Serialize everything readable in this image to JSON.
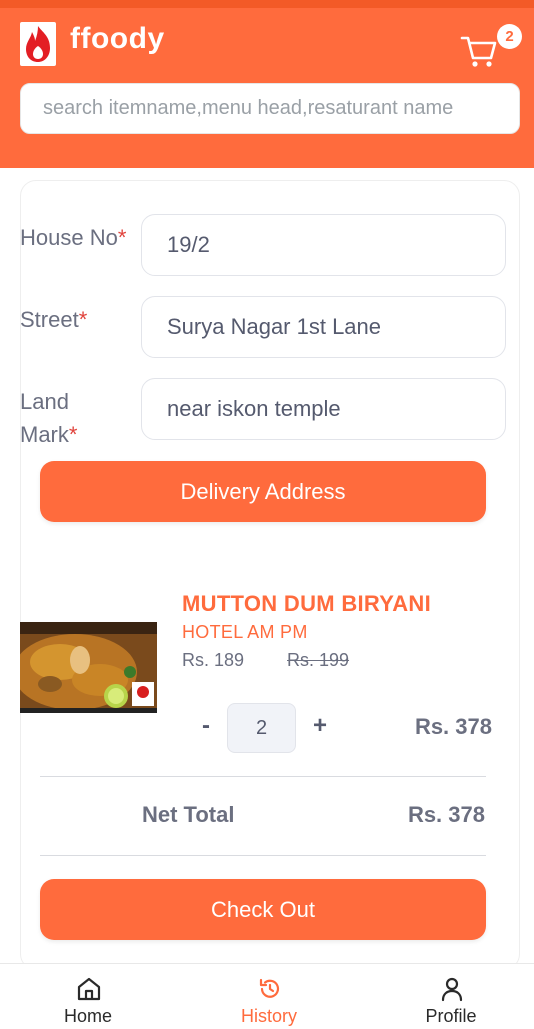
{
  "header": {
    "app_title": "ffoody",
    "cart_count": "2",
    "search_placeholder": "search itemname,menu head,resaturant name"
  },
  "address_form": {
    "house_no": {
      "label": "House No",
      "required_mark": "*",
      "value": "19/2"
    },
    "street": {
      "label": "Street",
      "required_mark": "*",
      "value": "Surya Nagar 1st Lane"
    },
    "landmark": {
      "label_line1": "Land",
      "label_line2": "Mark",
      "required_mark": "*",
      "value": "near iskon temple"
    },
    "submit_label": "Delivery Address"
  },
  "cart_item": {
    "name": "MUTTON DUM BIRYANI",
    "restaurant": "HOTEL AM PM",
    "price": "Rs. 189",
    "original_price": "Rs. 199",
    "minus_label": "-",
    "quantity": "2",
    "plus_label": "+",
    "line_total": "Rs. 378"
  },
  "summary": {
    "net_total_label": "Net Total",
    "net_total_value": "Rs. 378",
    "checkout_label": "Check Out"
  },
  "bottom_nav": {
    "home": "Home",
    "history": "History",
    "profile": "Profile",
    "active": "history"
  },
  "colors": {
    "brand": "#ff6b3d",
    "required": "#e0433c",
    "text_muted": "#6b6f80"
  }
}
